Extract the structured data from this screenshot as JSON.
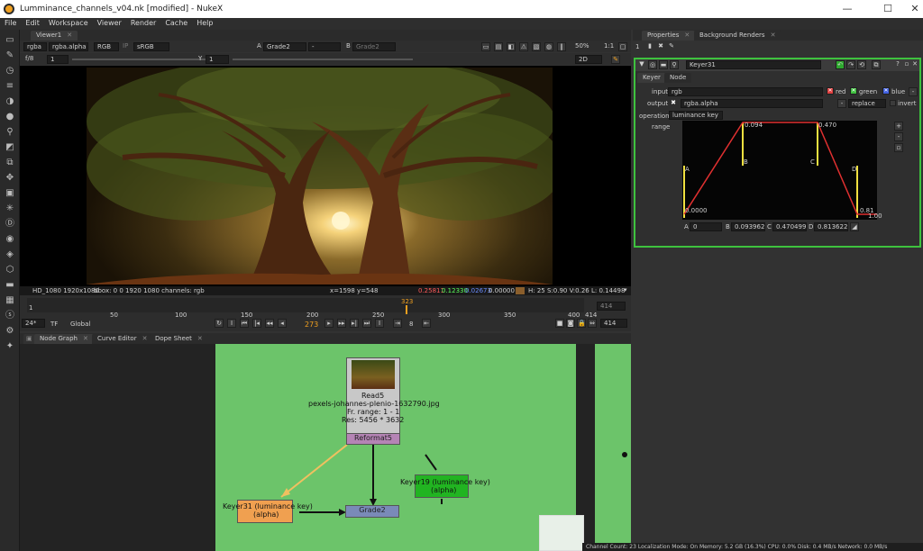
{
  "window": {
    "title": "Lumminance_channels_v04.nk [modified] - NukeX",
    "minimize": "—",
    "maximize": "☐",
    "close": "✕"
  },
  "menu": [
    "File",
    "Edit",
    "Workspace",
    "Viewer",
    "Render",
    "Cache",
    "Help"
  ],
  "viewer": {
    "tab": "Viewer1",
    "channels": "rgba",
    "alpha_channel": "rgba.alpha",
    "colorspace_a": "RGB",
    "colorspace_b": "sRGB",
    "a_label": "A",
    "a_input": "Grade2",
    "a_op": "-",
    "b_label": "B",
    "b_input": "Grade2",
    "zoom": "50%",
    "ratio": "1:1",
    "fstop": "f/8",
    "gain": "1",
    "y_label": "Y",
    "gamma": "1",
    "view_mode": "2D",
    "info_format": "HD_1080 1920x1080",
    "info_bbox": "bbox: 0 0 1920 1080 channels: rgb",
    "info_xy": "x=1598 y=548",
    "info_r": "0.25811",
    "info_g": "0.12330",
    "info_b": "0.02673",
    "info_a": "0.00000",
    "swatch_color": "#8a5e2c",
    "info_hsv": "H: 25 S:0.90 V:0.26  L: 0.14498"
  },
  "timeline": {
    "start": "1",
    "ticks": [
      "1",
      "50",
      "100",
      "150",
      "200",
      "250",
      "300",
      "350",
      "400",
      "414"
    ],
    "current_marker": "323",
    "end_field": "414",
    "fps": "24*",
    "tf": "TF",
    "global": "Global",
    "current_frame": "273",
    "step": "8",
    "end_field_2": "414",
    "left_field": "1"
  },
  "nodegraph": {
    "tabs": [
      "Node Graph",
      "Curve Editor",
      "Dope Sheet"
    ],
    "bg_color": "#6cc46a",
    "read_node": {
      "name": "Read5",
      "file": "pexels-johannes-plenio-1632790.jpg",
      "range": "Fr. range: 1 - 1",
      "res": "Res: 5456 * 3632"
    },
    "reformat": "Reformat5",
    "keyer19": {
      "title": "Keyer19 (luminance key)",
      "sub": "(alpha)"
    },
    "keyer31": {
      "title": "Keyer31 (luminance key)",
      "sub": "(alpha)"
    },
    "grade2": "Grade2"
  },
  "properties": {
    "tabs": [
      "Properties",
      "Background Renders"
    ],
    "count": "1",
    "node_name": "Keyer31",
    "sub_tabs": [
      "Keyer",
      "Node"
    ],
    "input_label": "input",
    "input_value": "rgb",
    "red": "red",
    "green": "green",
    "blue": "blue",
    "output_label": "output",
    "output_value": "rgba.alpha",
    "output_mode": "replace",
    "invert": "invert",
    "operation_label": "operation",
    "operation_value": "luminance key",
    "range_label": "range",
    "curve_labels": {
      "a": "A",
      "b": "B",
      "c": "C",
      "d": "D",
      "b_val": "0.094",
      "c_val": "0.470",
      "zero": "0.0000",
      "one": "1.00",
      "a_val_small": "0.81"
    },
    "range_values": {
      "a_label": "A",
      "a": "0",
      "b_label": "B",
      "b": "0.09396227",
      "c_label": "C",
      "c": "0.47049948",
      "d_label": "D",
      "d": "0.81362213"
    }
  },
  "status": "Channel Count: 23  Localization Mode: On  Memory: 5.2 GB (16.3%)  CPU: 0.0%  Disk: 0.4 MB/s  Network: 0.0 MB/s"
}
